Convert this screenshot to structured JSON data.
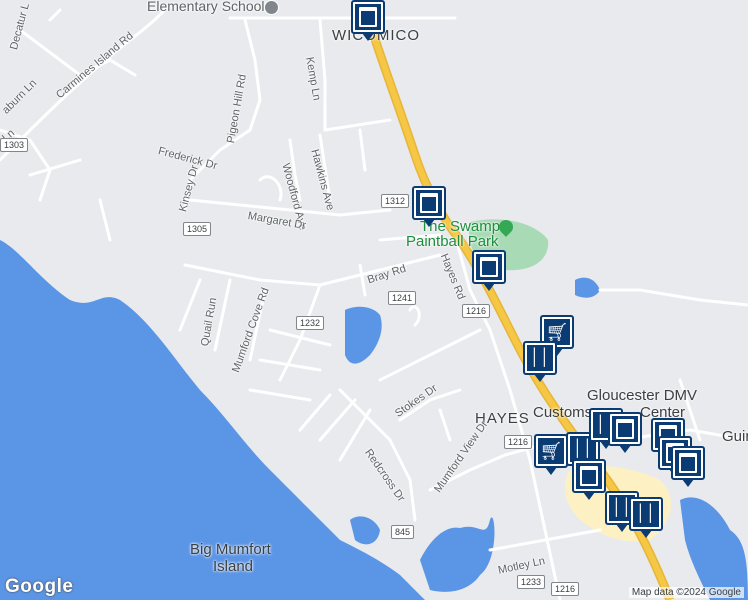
{
  "map": {
    "labels": {
      "elementary_school": "Elementary School",
      "wicomico": "WICOMICO",
      "hayes": "HAYES",
      "big_mumfort_line1": "Big Mumfort",
      "big_mumfort_line2": "Island",
      "swamp_line1": "The Swamp",
      "swamp_line2": "Paintball Park",
      "gloucester_dmv": "Gloucester DMV",
      "customs": "Customs",
      "center": "Center",
      "guin": "Guin"
    },
    "roads": {
      "carmines_island": "Carmines Island Rd",
      "decatur": "Decatur L",
      "raburn": "aburn Ln",
      "ln": "Ln",
      "kemp": "Kemp Ln",
      "pigeon_hill": "Pigeon Hill Rd",
      "frederick": "Frederick Dr",
      "hawkins": "Hawkins Ave",
      "woodford": "Woodford Ave",
      "kinsey": "Kinsey Dr",
      "margaret": "Margaret Dr",
      "bray": "Bray Rd",
      "hayes_rd": "Hayes Rd",
      "quail_run": "Quail Run",
      "mumford_cove": "Mumford Cove Rd",
      "stokes": "Stokes Dr",
      "redcross": "Redcross Dr",
      "mumford_view": "Mumford View Dr",
      "motley": "Motley Ln"
    },
    "shields": {
      "s1303": "1303",
      "s1305": "1305",
      "s1312": "1312",
      "s1241": "1241",
      "s1216a": "1216",
      "s1232": "1232",
      "s1216b": "1216",
      "s845": "845",
      "s1233": "1233",
      "s1216c": "1216"
    },
    "footer": {
      "logo": "Google",
      "attribution": "Map data ©2024 Google"
    },
    "colors": {
      "water": "#4285f4",
      "land": "#e8eaed",
      "highway": "#f6c744",
      "park": "#a8dab5",
      "pin_fill": "#0b3b73",
      "poi_green": "#1e8e3e"
    },
    "pins": [
      "shopping-bag-icon",
      "shopping-bag-icon",
      "shopping-bag-icon",
      "shopping-cart-icon",
      "restaurant-icon",
      "shopping-cart-icon",
      "restaurant-icon",
      "restaurant-icon",
      "shopping-bag-icon",
      "shopping-bag-icon",
      "restaurant-icon",
      "restaurant-icon"
    ]
  }
}
